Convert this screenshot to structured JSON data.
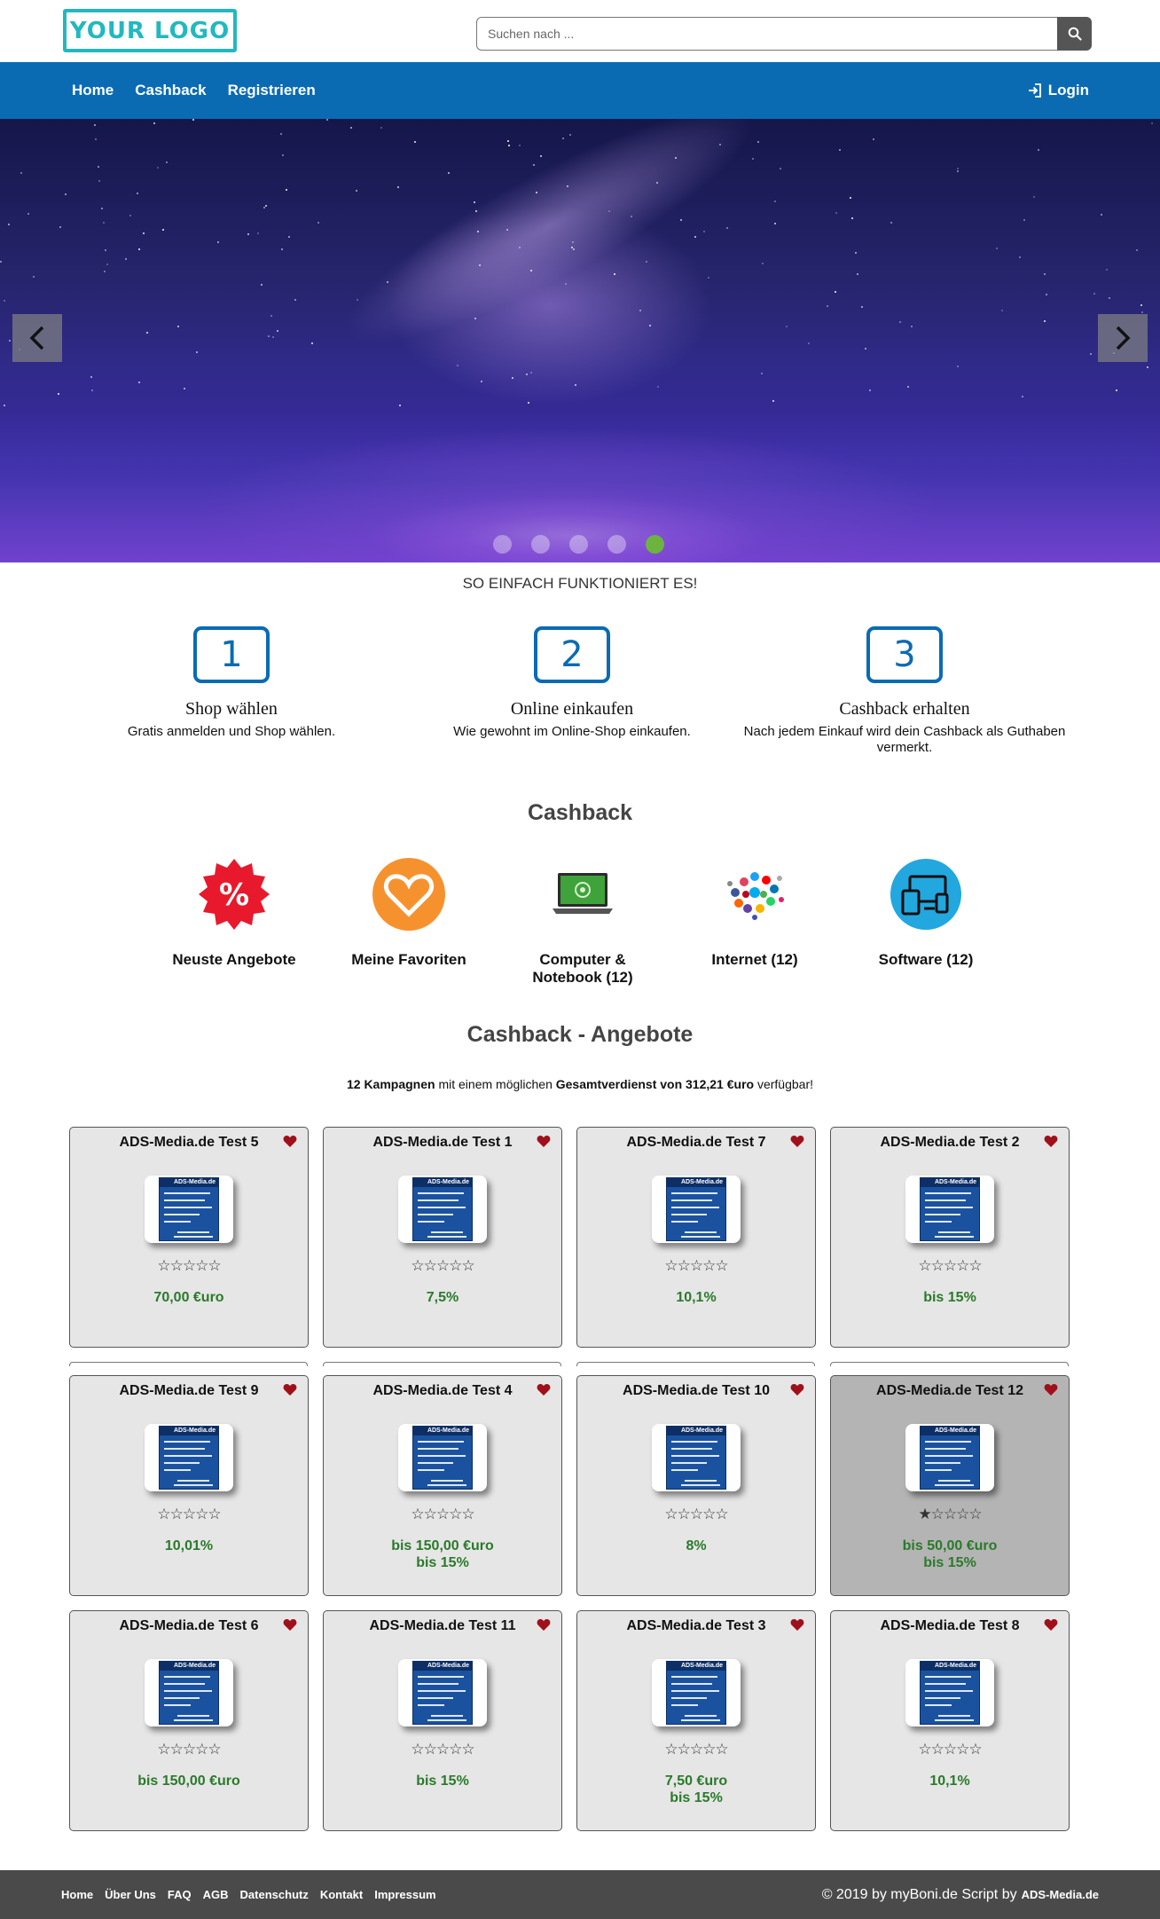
{
  "header": {
    "logo_text": "YOUR LOGO",
    "search_placeholder": "Suchen nach ...",
    "search_icon": "search-icon"
  },
  "nav": {
    "items": [
      "Home",
      "Cashback",
      "Registrieren"
    ],
    "login_label": "Login",
    "login_icon": "login-icon",
    "bar_color": "#0a6bb3"
  },
  "carousel": {
    "prev_icon": "chevron-left-icon",
    "next_icon": "chevron-right-icon",
    "slide_count": 5,
    "active_index": 4,
    "active_color": "#6db33f"
  },
  "howto": {
    "title": "SO EINFACH FUNKTIONIERT ES!",
    "steps": [
      {
        "num": "1",
        "title": "Shop wählen",
        "desc": "Gratis anmelden und Shop wählen."
      },
      {
        "num": "2",
        "title": "Online einkaufen",
        "desc": "Wie gewohnt im Online-Shop einkaufen."
      },
      {
        "num": "3",
        "title": "Cashback erhalten",
        "desc": "Nach jedem Einkauf wird dein Cashback als Guthaben vermerkt."
      }
    ]
  },
  "categories": {
    "title": "Cashback",
    "items": [
      {
        "label": "Neuste Angebote",
        "icon": "percent-badge-icon"
      },
      {
        "label": "Meine Favoriten",
        "icon": "heart-circle-icon"
      },
      {
        "label": "Computer & Notebook (12)",
        "icon": "laptop-icon"
      },
      {
        "label": "Internet (12)",
        "icon": "social-cloud-icon"
      },
      {
        "label": "Software (12)",
        "icon": "devices-icon"
      }
    ]
  },
  "offers": {
    "title": "Cashback - Angebote",
    "summary": {
      "count": "12 Kampagnen",
      "mid": " mit einem möglichen ",
      "total": "Gesamtverdienst von 312,21 €uro",
      "end": " verfügbar!"
    },
    "thumb_header": "ADS-Media.de",
    "value_color": "#2a7a2a",
    "cards": [
      {
        "name": "ADS-Media.de Test 5",
        "stars": "☆☆☆☆☆",
        "rating": 0,
        "value": "70,00 €uro",
        "value2": ""
      },
      {
        "name": "ADS-Media.de Test 1",
        "stars": "☆☆☆☆☆",
        "rating": 0,
        "value": "7,5%",
        "value2": ""
      },
      {
        "name": "ADS-Media.de Test 7",
        "stars": "☆☆☆☆☆",
        "rating": 0,
        "value": "10,1%",
        "value2": ""
      },
      {
        "name": "ADS-Media.de Test 2",
        "stars": "☆☆☆☆☆",
        "rating": 0,
        "value": "bis 15%",
        "value2": ""
      },
      {
        "name": "ADS-Media.de Test 9",
        "stars": "☆☆☆☆☆",
        "rating": 0,
        "value": "10,01%",
        "value2": ""
      },
      {
        "name": "ADS-Media.de Test 4",
        "stars": "☆☆☆☆☆",
        "rating": 0,
        "value": "bis 150,00 €uro",
        "value2": "bis 15%"
      },
      {
        "name": "ADS-Media.de Test 10",
        "stars": "☆☆☆☆☆",
        "rating": 0,
        "value": "8%",
        "value2": ""
      },
      {
        "name": "ADS-Media.de Test 12",
        "stars": "★☆☆☆☆",
        "rating": 1,
        "value": "bis 50,00 €uro",
        "value2": "bis 15%"
      },
      {
        "name": "ADS-Media.de Test 6",
        "stars": "☆☆☆☆☆",
        "rating": 0,
        "value": "bis 150,00 €uro",
        "value2": ""
      },
      {
        "name": "ADS-Media.de Test 11",
        "stars": "☆☆☆☆☆",
        "rating": 0,
        "value": "bis 15%",
        "value2": ""
      },
      {
        "name": "ADS-Media.de Test 3",
        "stars": "☆☆☆☆☆",
        "rating": 0,
        "value": "7,50 €uro",
        "value2": "bis 15%"
      },
      {
        "name": "ADS-Media.de Test 8",
        "stars": "☆☆☆☆☆",
        "rating": 0,
        "value": "10,1%",
        "value2": ""
      }
    ]
  },
  "footer": {
    "links": [
      "Home",
      "Über Uns",
      "FAQ",
      "AGB",
      "Datenschutz",
      "Kontakt",
      "Impressum"
    ],
    "copyright": "© 2019 by myBoni.de Script by",
    "brand": "ADS-Media.de"
  }
}
